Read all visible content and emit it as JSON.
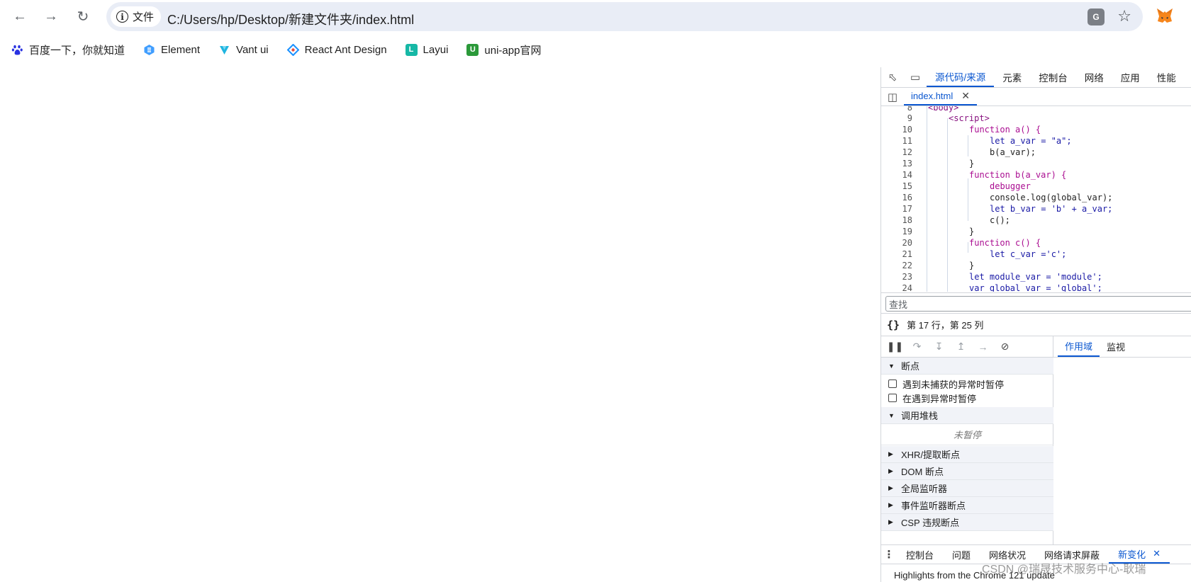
{
  "browser": {
    "security_chip": "文件",
    "url": "C:/Users/hp/Desktop/新建文件夹/index.html"
  },
  "bookmarks": [
    {
      "label": "百度一下，你就知道",
      "icon": "baidu-paw-icon",
      "color": "#2932e1"
    },
    {
      "label": "Element",
      "icon": "element-icon",
      "color": "#409eff"
    },
    {
      "label": "Vant ui",
      "icon": "vant-icon",
      "color": "#1fb5e0"
    },
    {
      "label": "React Ant Design",
      "icon": "antd-icon",
      "color": "#e94b3c"
    },
    {
      "label": "Layui",
      "icon": "layui-icon",
      "color": "#16b8a6"
    },
    {
      "label": "uni-app官网",
      "icon": "uniapp-icon",
      "color": "#2b9939"
    }
  ],
  "devtools": {
    "tabs": [
      "源代码/来源",
      "元素",
      "控制台",
      "网络",
      "应用",
      "性能"
    ],
    "active_tab": "源代码/来源",
    "file_tab": "index.html",
    "code_lines": [
      {
        "n": "8",
        "text": "<body>"
      },
      {
        "n": "9",
        "text": "<script>"
      },
      {
        "n": "10",
        "text": "function a() {"
      },
      {
        "n": "11",
        "text": "let a_var = \"a\";"
      },
      {
        "n": "12",
        "text": "b(a_var);"
      },
      {
        "n": "13",
        "text": "}"
      },
      {
        "n": "14",
        "text": "function b(a_var) {"
      },
      {
        "n": "15",
        "text": "debugger"
      },
      {
        "n": "16",
        "text": "console.log(global_var);"
      },
      {
        "n": "17",
        "text": "let b_var = 'b' + a_var;"
      },
      {
        "n": "18",
        "text": "c();"
      },
      {
        "n": "19",
        "text": "}"
      },
      {
        "n": "20",
        "text": "function c() {"
      },
      {
        "n": "21",
        "text": "let c_var ='c';"
      },
      {
        "n": "22",
        "text": "}"
      },
      {
        "n": "23",
        "text": "let module_var = 'module';"
      },
      {
        "n": "24",
        "text": "var global_var = 'global';"
      }
    ],
    "search_placeholder": "查找",
    "cursor_position": "第 17 行，第 25 列",
    "breakpoints_title": "断点",
    "pause_uncaught": "遇到未捕获的异常时暂停",
    "pause_caught": "在遇到异常时暂停",
    "call_stack_title": "调用堆栈",
    "not_paused": "未暂停",
    "sections": [
      "XHR/提取断点",
      "DOM 断点",
      "全局监听器",
      "事件监听器断点",
      "CSP 违规断点"
    ],
    "scope_tabs": [
      "作用域",
      "监视"
    ],
    "drawer_tabs": [
      "控制台",
      "问题",
      "网络状况",
      "网络请求屏蔽",
      "新变化"
    ],
    "drawer_body": "Highlights from the Chrome 121 update"
  },
  "watermark": "CSDN @瑞晟技术服务中心-耿瑞"
}
